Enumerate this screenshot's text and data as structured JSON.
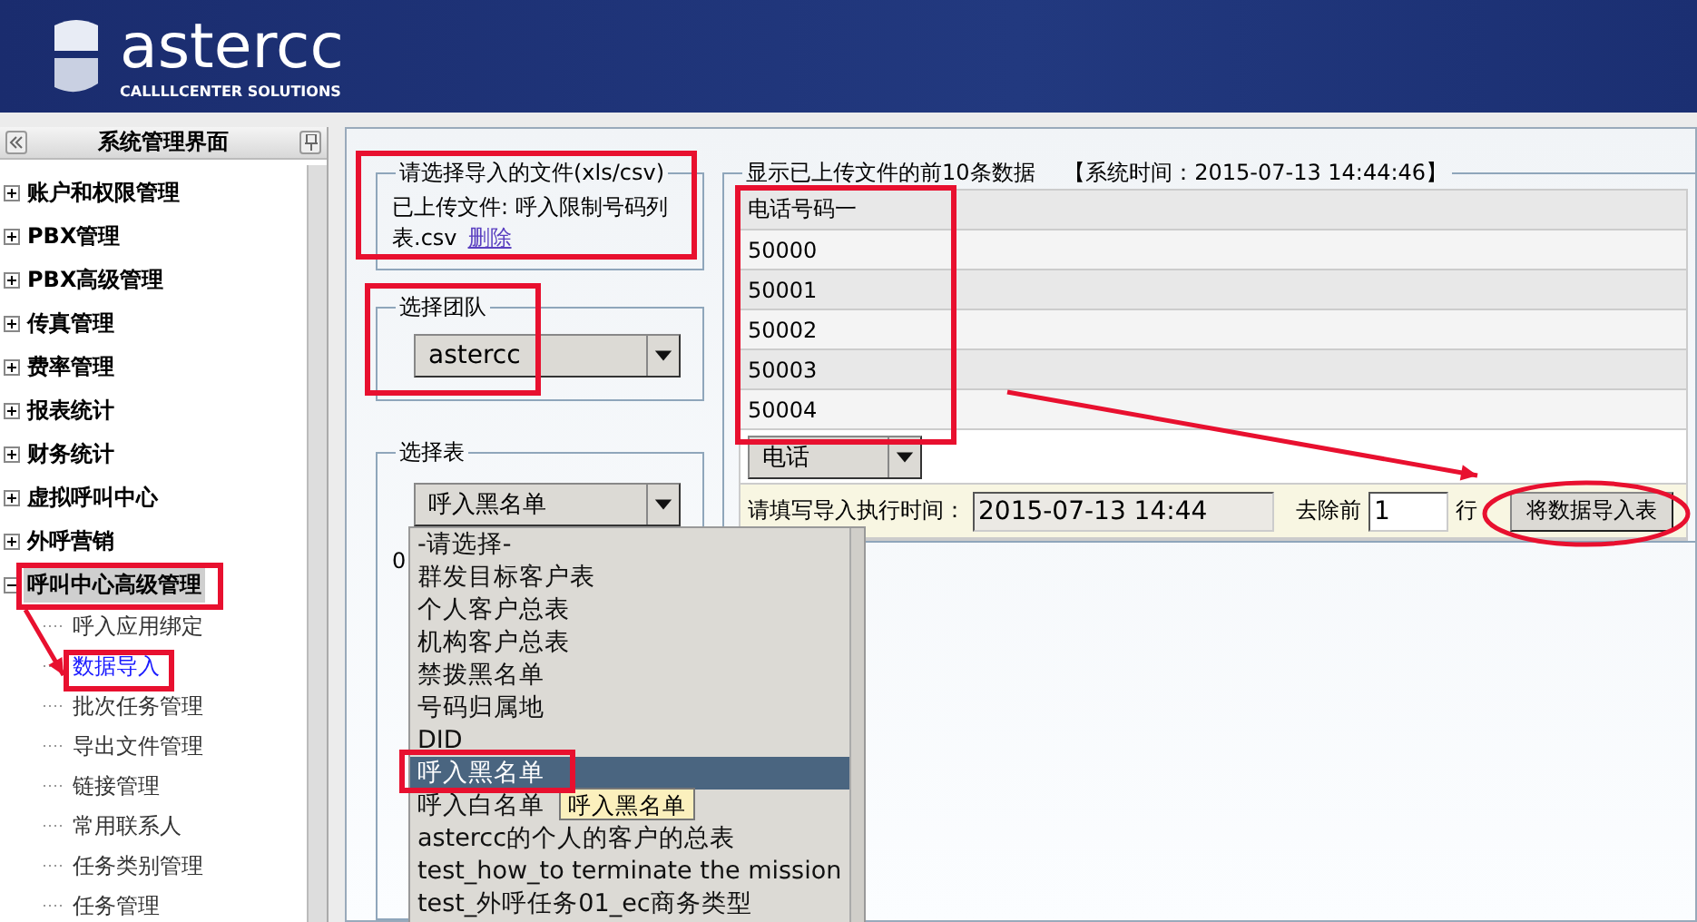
{
  "header": {
    "logo_text": "astercc",
    "tagline": "CALLLLCENTER SOLUTIONS"
  },
  "sidebar": {
    "title": "系统管理界面",
    "items": [
      {
        "label": "账户和权限管理",
        "expanded": false,
        "selected": false
      },
      {
        "label": "PBX管理",
        "expanded": false,
        "selected": false
      },
      {
        "label": "PBX高级管理",
        "expanded": false,
        "selected": false
      },
      {
        "label": "传真管理",
        "expanded": false,
        "selected": false
      },
      {
        "label": "费率管理",
        "expanded": false,
        "selected": false
      },
      {
        "label": "报表统计",
        "expanded": false,
        "selected": false
      },
      {
        "label": "财务统计",
        "expanded": false,
        "selected": false
      },
      {
        "label": "虚拟呼叫中心",
        "expanded": false,
        "selected": false
      },
      {
        "label": "外呼营销",
        "expanded": false,
        "selected": false
      },
      {
        "label": "呼叫中心高级管理",
        "expanded": true,
        "selected": true,
        "children": [
          {
            "label": "呼入应用绑定",
            "selected": false
          },
          {
            "label": "数据导入",
            "selected": true
          },
          {
            "label": "批次任务管理",
            "selected": false
          },
          {
            "label": "导出文件管理",
            "selected": false
          },
          {
            "label": "链接管理",
            "selected": false
          },
          {
            "label": "常用联系人",
            "selected": false
          },
          {
            "label": "任务类别管理",
            "selected": false
          },
          {
            "label": "任务管理",
            "selected": false
          }
        ]
      }
    ]
  },
  "file_box": {
    "legend": "请选择导入的文件(xls/csv)",
    "uploaded": "已上传文件: 呼入限制号码列表.csv",
    "delete_link": "删除"
  },
  "team_box": {
    "legend": "选择团队",
    "value": "astercc"
  },
  "table_box": {
    "legend": "选择表",
    "value": "呼入黑名单",
    "note": "0",
    "tooltip": "呼入黑名单",
    "options": [
      {
        "label": "-请选择-",
        "selected": false
      },
      {
        "label": "群发目标客户表",
        "selected": false
      },
      {
        "label": "个人客户总表",
        "selected": false
      },
      {
        "label": "机构客户总表",
        "selected": false
      },
      {
        "label": "禁拨黑名单",
        "selected": false
      },
      {
        "label": "号码归属地",
        "selected": false
      },
      {
        "label": "DID",
        "selected": false
      },
      {
        "label": "呼入黑名单",
        "selected": true
      },
      {
        "label": "呼入白名单",
        "selected": false
      },
      {
        "label": "astercc的个人的客户的总表",
        "selected": false
      },
      {
        "label": "test_how_to terminate the mission",
        "selected": false
      },
      {
        "label": "test_外呼任务01_ec商务类型",
        "selected": false
      }
    ]
  },
  "preview": {
    "legend": "显示已上传文件的前10条数据",
    "system_time": "【系统时间：2015-07-13 14:44:46】",
    "columns": [
      "电话号码一"
    ],
    "rows": [
      "50000",
      "50001",
      "50002",
      "50003",
      "50004"
    ],
    "field_select": "电话",
    "time_label": "请填写导入执行时间：",
    "time_value": "2015-07-13 14:44",
    "skip_label": "去除前",
    "skip_value": "1",
    "skip_unit": "行",
    "import_button": "将数据导入表"
  }
}
